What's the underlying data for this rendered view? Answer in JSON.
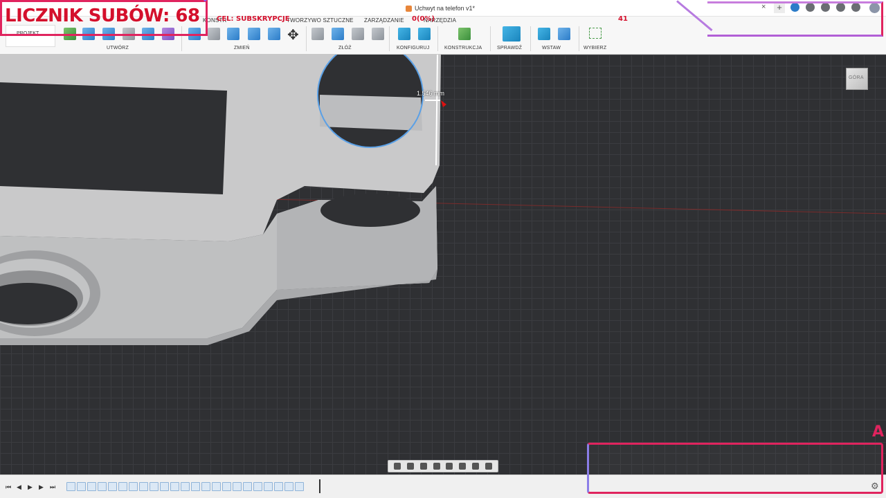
{
  "window": {
    "doc_title": "Uchwyt na telefon v1*",
    "close_label": "×",
    "new_tab_label": "+"
  },
  "ribbon": {
    "tabs": [
      "KONSTR",
      "TWORZYWO SZTUCZNE",
      "ZARZĄDZANIE",
      "NARZĘDZIA"
    ],
    "project_label": "PROJEKT",
    "groups": {
      "create": "UTWÓRZ",
      "modify": "ZMIEŃ",
      "assemble": "ZŁÓŻ",
      "configure": "KONFIGURUJ",
      "construct": "KONSTRUKCJA",
      "inspect": "SPRAWDŹ",
      "insert": "WSTAW",
      "select": "WYBIERZ"
    }
  },
  "overlay": {
    "counter": "LICZNIK SUBÓW: 68",
    "goal": "CEL: SUBSKRYPCJE",
    "goal_percent": "0(0%)",
    "goal_number": "41",
    "corner_letter": "A"
  },
  "viewport": {
    "dimension_label": "1.546 mm",
    "viewcube_label": "GÓRA"
  },
  "colors": {
    "accent": "#e0245e",
    "selection": "#5aa0e6",
    "viewport_bg": "#2f3033"
  },
  "icons": {
    "move": "move-icon",
    "settings": "gear-icon"
  }
}
